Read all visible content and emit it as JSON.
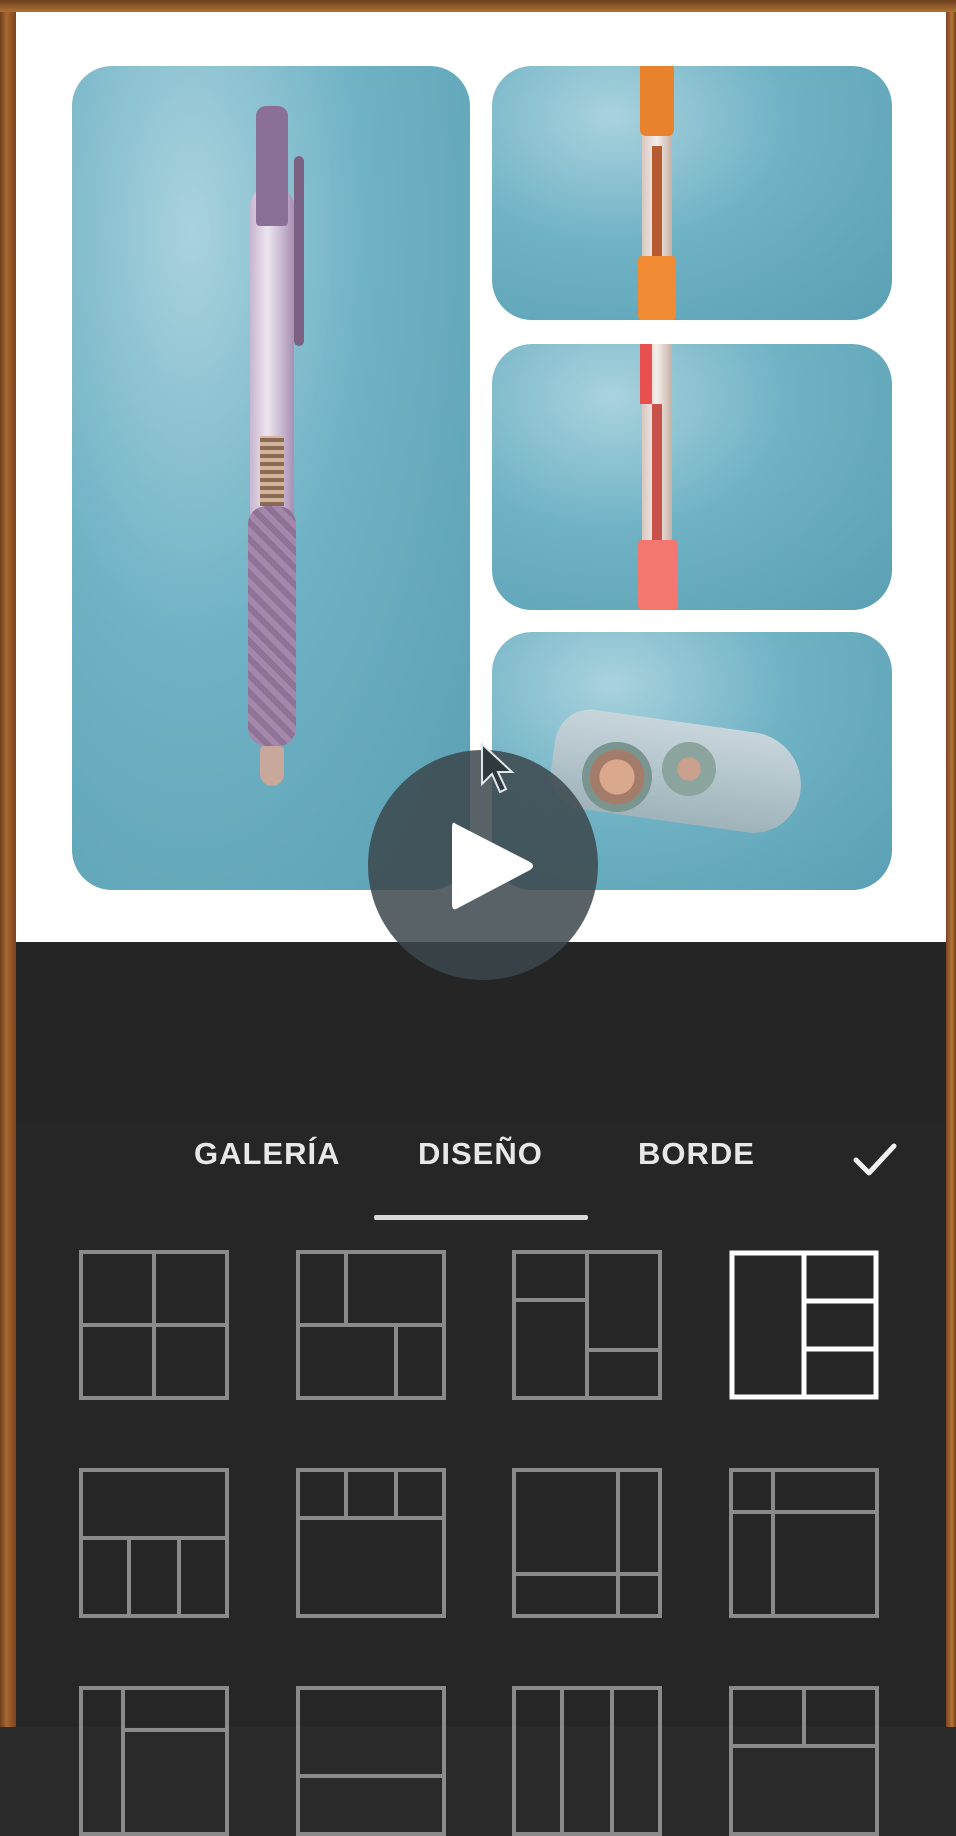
{
  "tabs": {
    "galeria": "GALERÍA",
    "diseno": "DISEÑO",
    "borde": "BORDE",
    "active": "DISEÑO"
  },
  "colors": {
    "accent": "#d8d8d8",
    "panel": "#262626",
    "layout_outline": "#8a8a8a",
    "layout_selected": "#ffffff"
  },
  "icons": {
    "play": "play-icon",
    "confirm": "checkmark-icon",
    "cursor": "mouse-cursor-icon"
  }
}
